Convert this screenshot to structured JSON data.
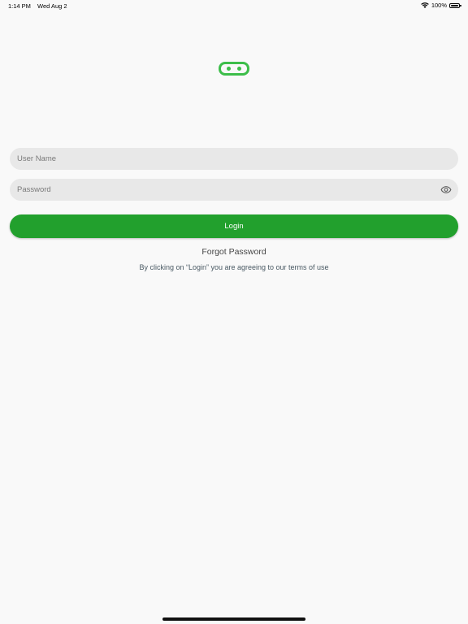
{
  "status_bar": {
    "time": "1:14 PM",
    "date": "Wed Aug 2",
    "battery": "100%",
    "icons": [
      "wifi-icon",
      "battery-icon"
    ]
  },
  "logo": {
    "icon": "app-logo-icon",
    "color": "#3dbe4a"
  },
  "form": {
    "username_placeholder": "User Name",
    "username_value": "",
    "password_placeholder": "Password",
    "password_value": "",
    "password_toggle_icon": "eye-icon",
    "login_label": "Login",
    "forgot_label": "Forgot Password",
    "terms_text": "By clicking on “Login” you are agreeing to our terms of use"
  },
  "colors": {
    "accent": "#22a02d",
    "field_bg": "#e8e8e8",
    "background": "#f9f9f9"
  }
}
